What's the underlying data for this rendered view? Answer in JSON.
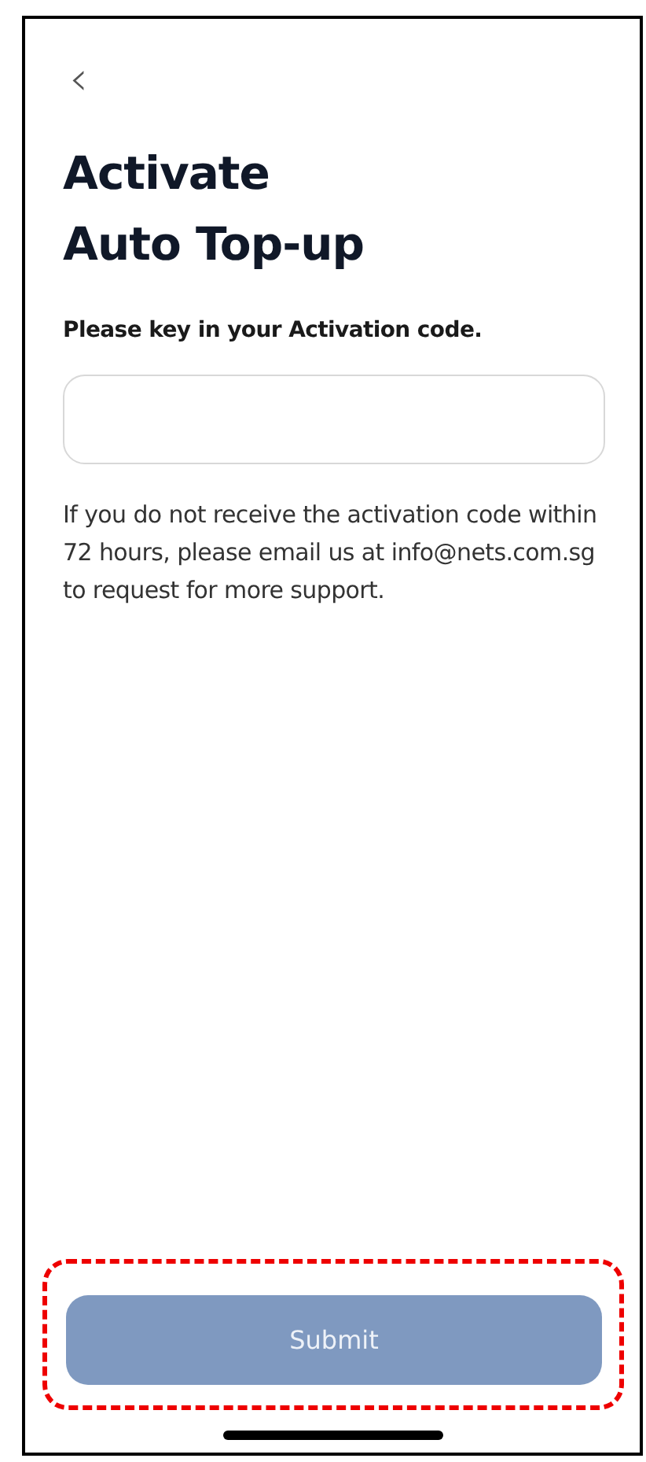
{
  "back": {
    "label": "‹"
  },
  "title": {
    "lines": [
      "Activate",
      "Auto Top-up"
    ]
  },
  "field": {
    "label": "Please key in your Activation code."
  },
  "help": {
    "text": "If you do not receive the activation code within 72 hours, please email us at info@nets.com.sg to request for more support."
  },
  "submit": {
    "label": "Submit",
    "disabled": true,
    "highlighted": true
  }
}
